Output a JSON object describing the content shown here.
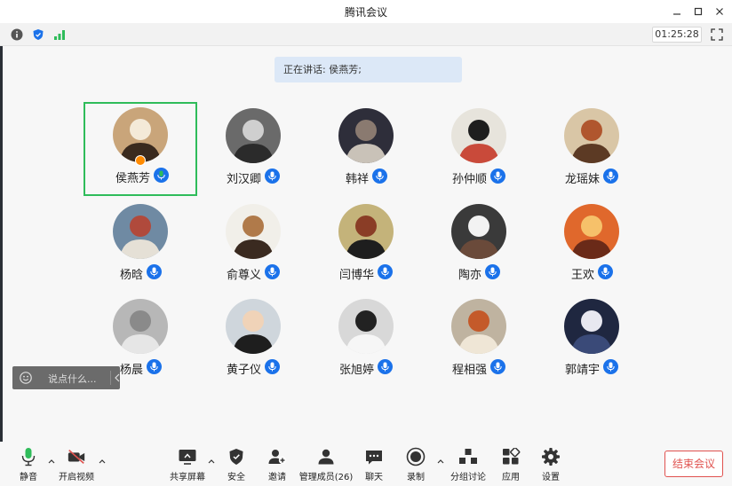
{
  "window": {
    "title": "腾讯会议"
  },
  "statusbar": {
    "icons": [
      "info-icon",
      "shield-icon",
      "signal-icon"
    ],
    "timer": "01:25:28"
  },
  "speaking": {
    "text": "正在讲话: 侯燕芳;"
  },
  "participants": [
    {
      "name": "侯燕芳"
    },
    {
      "name": "刘汉卿"
    },
    {
      "name": "韩祥"
    },
    {
      "name": "孙仲顺"
    },
    {
      "name": "龙瑶妹"
    },
    {
      "name": "杨晗"
    },
    {
      "name": "俞尊义"
    },
    {
      "name": "闫博华"
    },
    {
      "name": "陶亦"
    },
    {
      "name": "王欢"
    },
    {
      "name": "杨晨"
    },
    {
      "name": "黄子仪"
    },
    {
      "name": "张旭婷"
    },
    {
      "name": "程相强"
    },
    {
      "name": "郭靖宇"
    }
  ],
  "chat": {
    "placeholder": "说点什么..."
  },
  "toolbar": {
    "mute": "静音",
    "video": "开启视频",
    "share": "共享屏幕",
    "security": "安全",
    "invite": "邀请",
    "members": "管理成员(26)",
    "chat": "聊天",
    "record": "录制",
    "breakout": "分组讨论",
    "apps": "应用",
    "settings": "设置",
    "end": "结束会议"
  },
  "colors": {
    "accent": "#1b72ea",
    "active_border": "#2fbc5a",
    "mic_on": "#2fbc5a",
    "end": "#e0524f"
  }
}
